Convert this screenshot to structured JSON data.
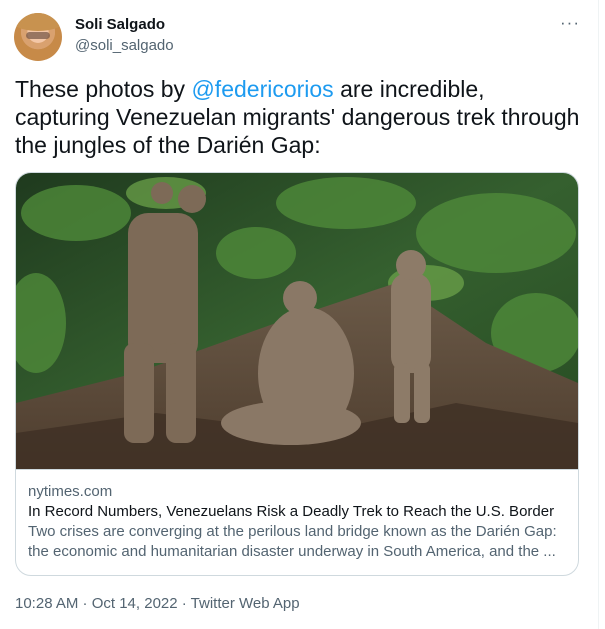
{
  "author": {
    "name": "Soli Salgado",
    "handle": "@soli_salgado"
  },
  "menu": {
    "more_icon": "more-horizontal-icon",
    "label": "···"
  },
  "tweet": {
    "text_before": "These photos by ",
    "mention": "@federicorios",
    "text_after": " are incredible, capturing Venezuelan migrants' dangerous trek through the jungles of the Darién Gap:"
  },
  "link_card": {
    "domain": "nytimes.com",
    "title": "In Record Numbers, Venezuelans Risk a Deadly Trek to Reach the U.S. Border",
    "description": "Two crises are converging at the perilous land bridge known as the Darién Gap: the economic and humanitarian disaster underway in South America, and the ..."
  },
  "meta": {
    "timestamp": "10:28 AM · Oct 14, 2022 · Twitter Web App"
  },
  "colors": {
    "link": "#1d9bf0",
    "secondary_text": "#536471",
    "primary_text": "#0f1419",
    "border": "#cfd9de"
  }
}
